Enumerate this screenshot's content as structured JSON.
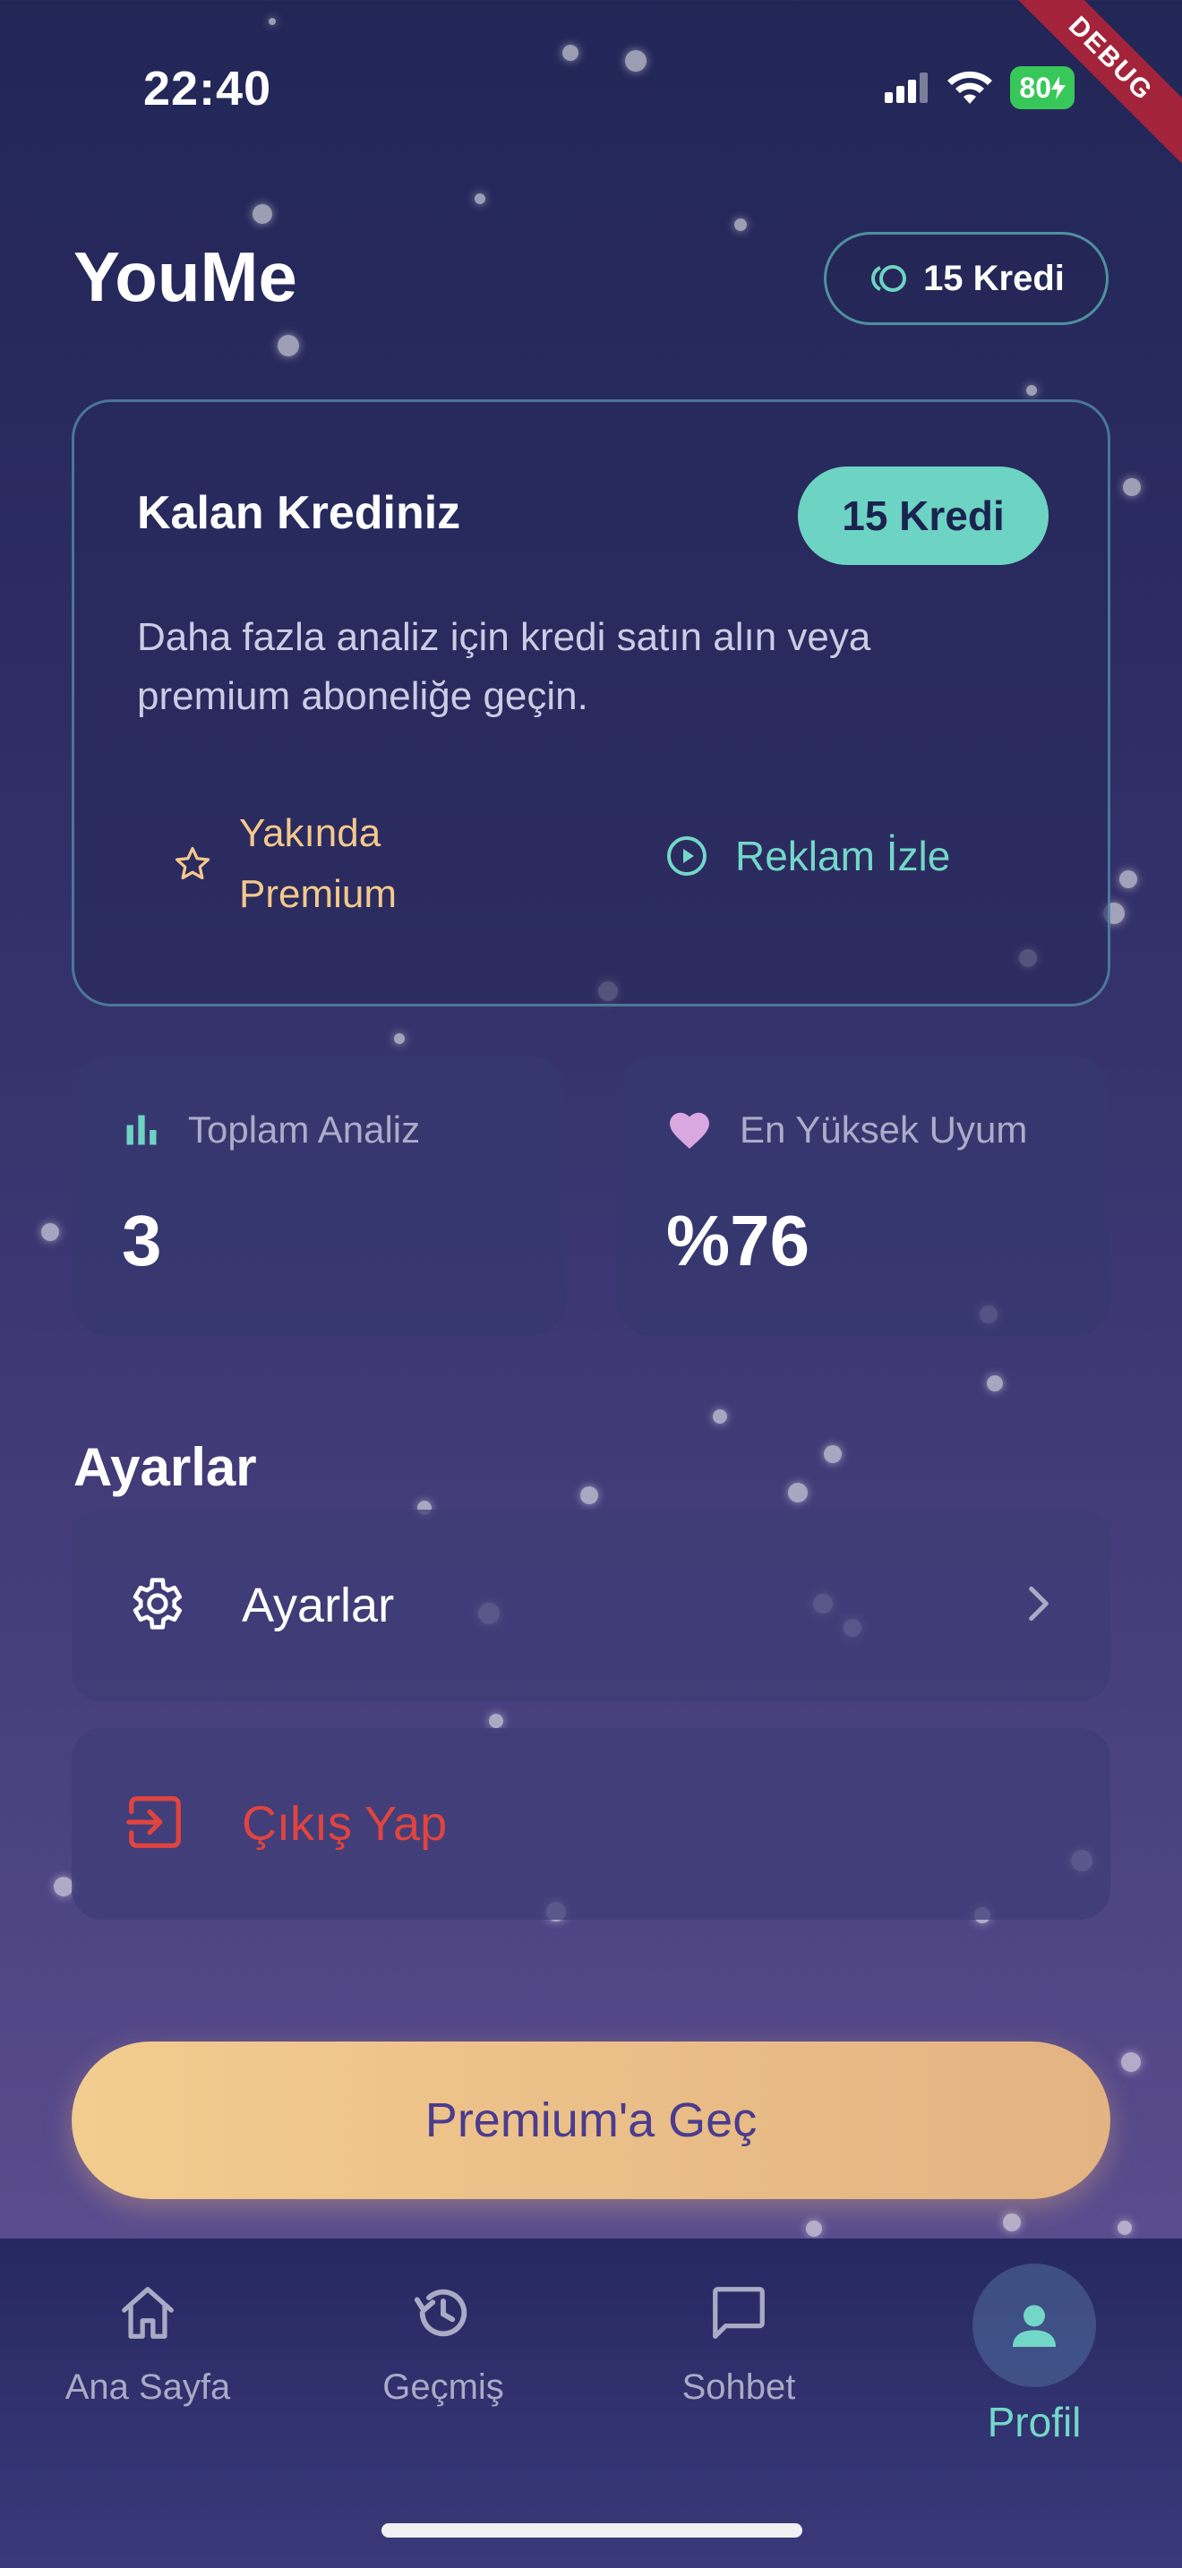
{
  "status_bar": {
    "time": "22:40",
    "battery": "80",
    "debug_label": "DEBUG",
    "icons": [
      "signal-icon",
      "wifi-icon",
      "battery-icon"
    ]
  },
  "header": {
    "title": "YouMe",
    "credit_pill": "15 Kredi"
  },
  "credit_card": {
    "title": "Kalan Krediniz",
    "badge": "15 Kredi",
    "description": "Daha fazla analiz için kredi satın alın veya premium aboneliğe geçin.",
    "coming_line1": "Yakında",
    "coming_line2": "Premium",
    "watch_ad": "Reklam İzle"
  },
  "stats": {
    "total_label": "Toplam Analiz",
    "total_value": "3",
    "best_label": "En Yüksek Uyum",
    "best_value": "%76"
  },
  "settings": {
    "section_title": "Ayarlar",
    "settings_label": "Ayarlar",
    "logout_label": "Çıkış Yap"
  },
  "premium_button": "Premium'a Geç",
  "bottom_nav": {
    "home": "Ana Sayfa",
    "history": "Geçmiş",
    "chat": "Sohbet",
    "profile": "Profil"
  },
  "colors": {
    "accent_teal": "#6dd3c3",
    "accent_gold": "#f3c98b",
    "danger": "#e0443f",
    "heart": "#d9a8e0"
  }
}
